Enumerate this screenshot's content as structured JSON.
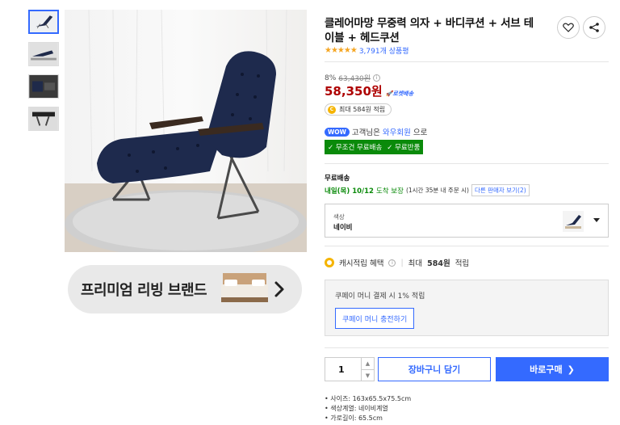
{
  "product": {
    "title": "클레어마망 무중력 의자 + 바디쿠션 + 서브 테이블 + 헤드쿠션",
    "rating_stars": "★★★★★",
    "rating_value": 4.5,
    "review_count": "3,791개 상품평"
  },
  "price": {
    "discount_rate": "8%",
    "original_price": "63,430원",
    "sale_price": "58,350원",
    "rocket_label": "로켓배송"
  },
  "reward": {
    "max_points": "최대 584원 적립"
  },
  "wow": {
    "badge": "WOW",
    "text_prefix": "고객님은",
    "link": "와우회원",
    "text_suffix": "으로",
    "free_ship": "✓ 무조건 무료배송",
    "free_return": "✓ 무료반품"
  },
  "shipping": {
    "title": "무료배송",
    "date": "내일(목) 10/12",
    "guarantee": "도착 보장",
    "condition": "(1시간 35분 내 주문 시)",
    "other_sellers": "다른 판매자 보기(2)"
  },
  "option": {
    "label": "색상",
    "value": "네이비"
  },
  "cash": {
    "label": "캐시적립 혜택",
    "max_prefix": "최대",
    "max_amount": "584원",
    "max_suffix": "적립"
  },
  "coupay": {
    "text": "쿠페이 머니 결제 시 1% 적립",
    "charge_button": "쿠페이 머니 충전하기"
  },
  "purchase": {
    "quantity": "1",
    "cart_button": "장바구니 담기",
    "buy_button": "바로구매",
    "buy_arrow": "❯"
  },
  "specs": [
    "사이즈: 163x65.5x75.5cm",
    "색상계열: 네이비계열",
    "가로길이: 65.5cm"
  ],
  "banner": {
    "text": "프리미엄 리빙 브랜드"
  },
  "colors": {
    "accent": "#346aff",
    "price": "#ae0000",
    "free_badge": "#0a8a0a",
    "star": "#f5a623"
  }
}
